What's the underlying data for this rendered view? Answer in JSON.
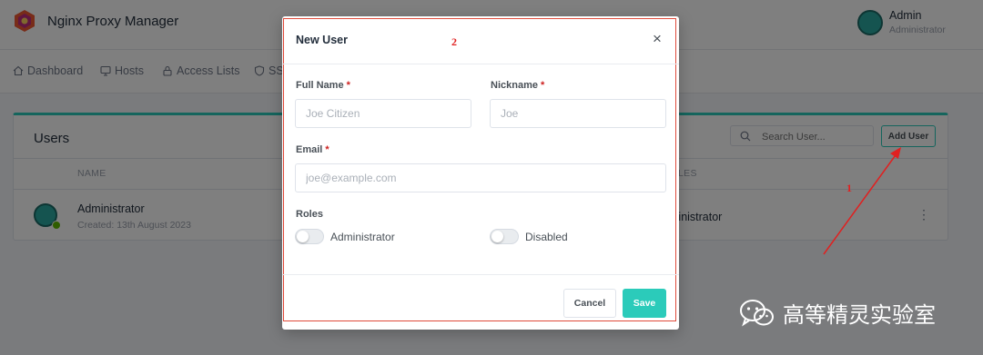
{
  "app": {
    "title": "Nginx Proxy Manager",
    "user_name": "Admin",
    "user_role": "Administrator",
    "brand_color": "#2bcbba"
  },
  "nav": {
    "items": [
      {
        "label": "Dashboard",
        "icon": "home-icon"
      },
      {
        "label": "Hosts",
        "icon": "monitor-icon"
      },
      {
        "label": "Access Lists",
        "icon": "lock-icon"
      },
      {
        "label": "SS",
        "icon": "shield-icon"
      }
    ]
  },
  "users_card": {
    "title": "Users",
    "search_placeholder": "Search User...",
    "add_user_label": "Add User",
    "columns": [
      "NAME",
      "LES"
    ],
    "rows": [
      {
        "name": "Administrator",
        "created": "Created: 13th August 2023",
        "roles": "ministrator",
        "status": "online"
      }
    ]
  },
  "modal": {
    "title": "New User",
    "full_name_label": "Full Name",
    "full_name_placeholder": "Joe Citizen",
    "nickname_label": "Nickname",
    "nickname_placeholder": "Joe",
    "email_label": "Email",
    "email_placeholder": "joe@example.com",
    "required_mark": "*",
    "roles_label": "Roles",
    "toggle_admin_label": "Administrator",
    "toggle_admin_on": false,
    "toggle_disabled_label": "Disabled",
    "toggle_disabled_on": false,
    "cancel_label": "Cancel",
    "save_label": "Save"
  },
  "annotations": {
    "step_1": "1",
    "step_2": "2",
    "color": "#e02020"
  },
  "watermark": {
    "text": "高等精灵实验室",
    "icon": "wechat-icon"
  }
}
